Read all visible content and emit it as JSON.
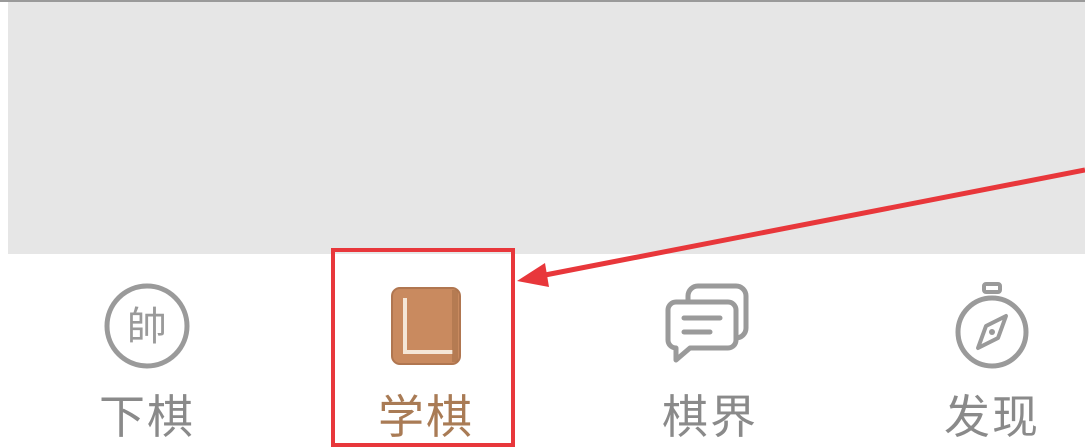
{
  "tab_bar": {
    "tabs": [
      {
        "label": "下棋",
        "icon": "shuai-piece-icon",
        "active": false,
        "icon_glyph": "帥"
      },
      {
        "label": "学棋",
        "icon": "book-icon",
        "active": true
      },
      {
        "label": "棋界",
        "icon": "chat-bubbles-icon",
        "active": false
      },
      {
        "label": "发现",
        "icon": "compass-icon",
        "active": false
      }
    ]
  },
  "colors": {
    "inactive": "#8a8a8a",
    "active": "#a97b55",
    "highlight": "#e8373b",
    "panel": "#e6e6e6"
  }
}
